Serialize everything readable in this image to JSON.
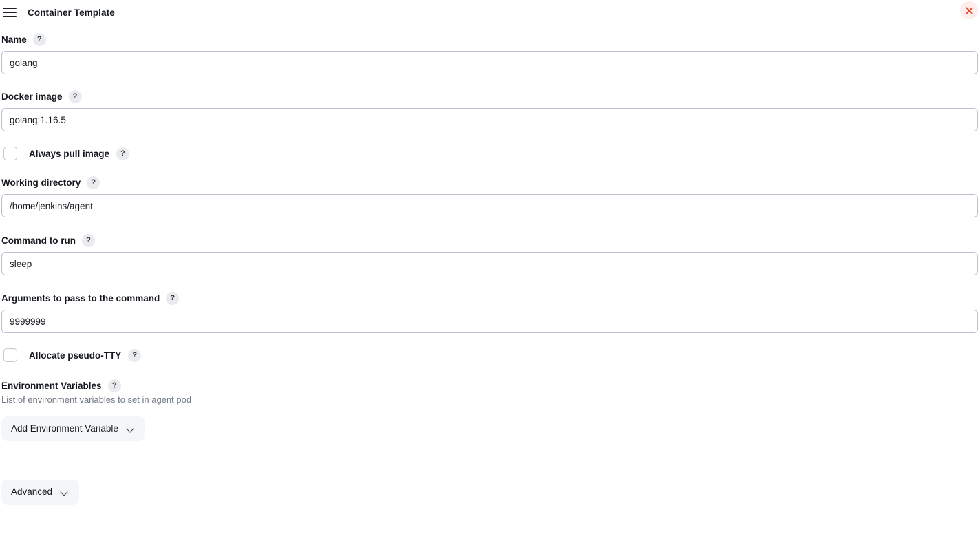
{
  "header": {
    "title": "Container Template",
    "menu_icon": "hamburger-menu-icon",
    "close_icon": "close-x-icon"
  },
  "help_badge_label": "?",
  "form": {
    "fields": [
      {
        "type": "text",
        "label": "Name",
        "help": "?",
        "value": "golang",
        "placeholder": "",
        "name": "name"
      },
      {
        "type": "text",
        "label": "Docker image",
        "help": "?",
        "value": "golang:1.16.5",
        "placeholder": "",
        "name": "docker-image"
      },
      {
        "type": "checkbox",
        "label": "Always pull image",
        "help": "?",
        "checked": false,
        "name": "always-pull-image"
      },
      {
        "type": "text",
        "label": "Working directory",
        "help": "?",
        "value": "/home/jenkins/agent",
        "placeholder": "",
        "name": "working-directory"
      },
      {
        "type": "text",
        "label": "Command to run",
        "help": "?",
        "value": "sleep",
        "placeholder": "",
        "name": "command-to-run"
      },
      {
        "type": "text",
        "label": "Arguments to pass to the command",
        "help": "?",
        "value": "9999999",
        "placeholder": "",
        "name": "arguments"
      },
      {
        "type": "checkbox",
        "label": "Allocate pseudo-TTY",
        "help": "?",
        "checked": false,
        "name": "allocate-pseudo-tty"
      }
    ],
    "env_section": {
      "label": "Environment Variables",
      "help": "?",
      "description": "List of environment variables to set in agent pod",
      "add_button_label": "Add Environment Variable"
    },
    "advanced_button_label": "Advanced"
  },
  "colors": {
    "text": "#15191f",
    "muted": "#6f7884",
    "input_border": "#b9c1cc",
    "badge_bg": "#e9ebee",
    "pill_bg": "#f5f6f8",
    "close_bg": "#fdeeec",
    "close_fg": "#e8462c"
  }
}
